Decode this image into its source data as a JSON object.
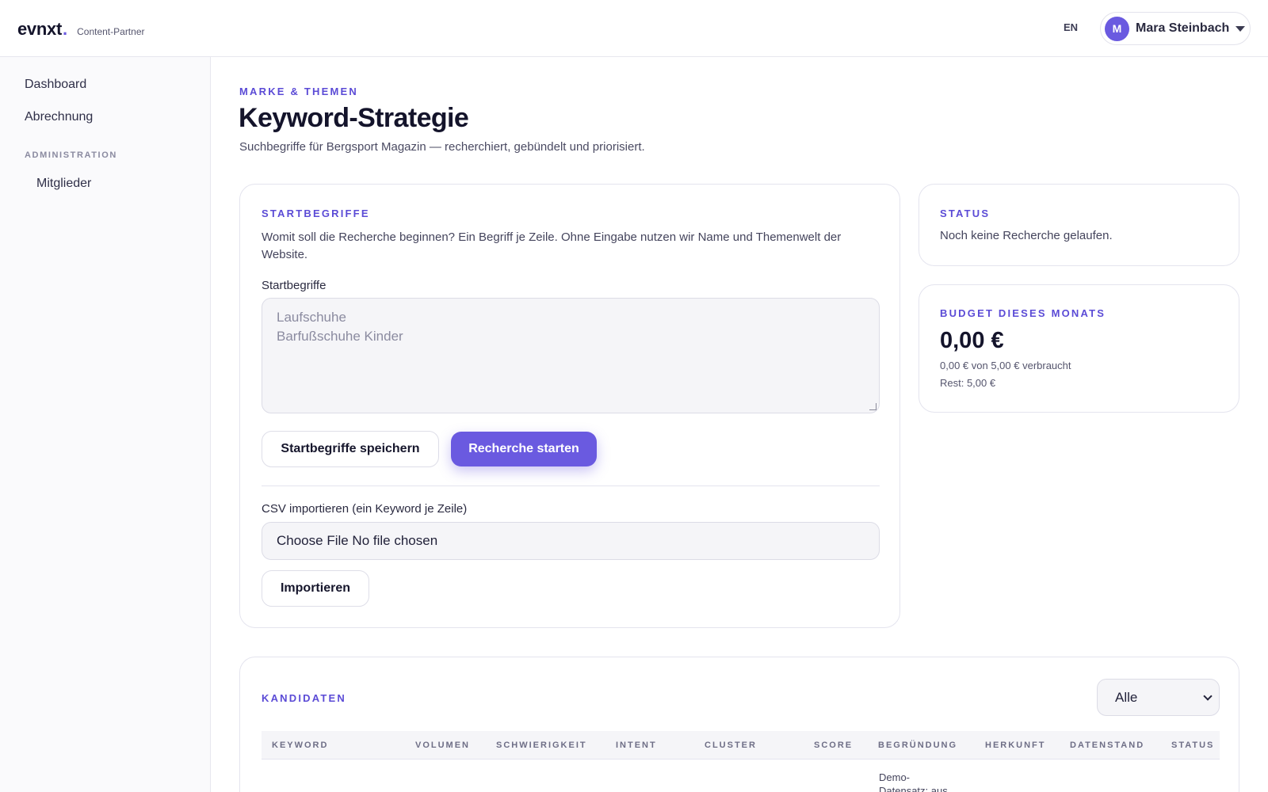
{
  "header": {
    "logo_text": "evnxt",
    "logo_dot": ".",
    "logo_sub": "Content-Partner",
    "language": "EN",
    "user": {
      "initial": "M",
      "name": "Mara Steinbach"
    }
  },
  "sidebar": {
    "items": [
      {
        "label": "Dashboard"
      },
      {
        "label": "Abrechnung"
      }
    ],
    "section_label": "ADMINISTRATION",
    "section_items": [
      {
        "label": "Mitglieder"
      }
    ]
  },
  "page": {
    "eyebrow": "MARKE & THEMEN",
    "title": "Keyword-Strategie",
    "subtitle": "Suchbegriffe für Bergsport Magazin — recherchiert, gebündelt und priorisiert."
  },
  "start_card": {
    "label": "STARTBEGRIFFE",
    "description": "Womit soll die Recherche beginnen? Ein Begriff je Zeile. Ohne Eingabe nutzen wir Name und Themenwelt der Website.",
    "field_label": "Startbegriffe",
    "placeholder": "Laufschuhe\nBarfußschuhe Kinder",
    "save_button": "Startbegriffe speichern",
    "start_button": "Recherche starten",
    "csv_label": "CSV importieren (ein Keyword je Zeile)",
    "file_input_text": "Choose File No file chosen",
    "import_button": "Importieren"
  },
  "status_card": {
    "label": "STATUS",
    "text": "Noch keine Recherche gelaufen."
  },
  "budget_card": {
    "label": "BUDGET DIESES MONATS",
    "amount": "0,00 €",
    "used_line": "0,00 € von 5,00 € verbraucht",
    "rest_line": "Rest: 5,00 €"
  },
  "candidates": {
    "label": "KANDIDATEN",
    "filter_value": "Alle",
    "columns": [
      "KEYWORD",
      "VOLUMEN",
      "SCHWIERIGKEIT",
      "INTENT",
      "CLUSTER",
      "SCORE",
      "BEGRÜNDUNG",
      "HERKUNFT",
      "DATENSTAND",
      "STATUS"
    ],
    "first_row_note": "Demo-Datensatz; aus"
  },
  "colors": {
    "accent": "#6a5ae0",
    "label_accent": "#5b4bd6"
  }
}
